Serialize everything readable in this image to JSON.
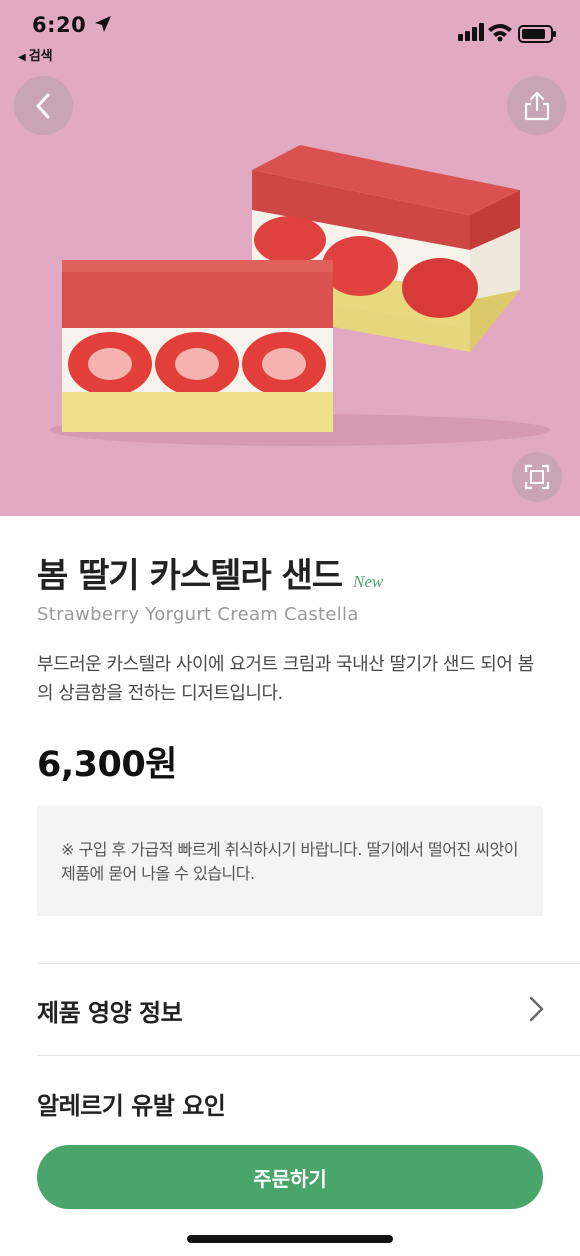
{
  "status_bar": {
    "time": "6:20",
    "back_label": "검색"
  },
  "hero": {
    "background_color": "#e2a9c2",
    "image_alt": "strawberry castella sandwich"
  },
  "product": {
    "title": "봄 딸기 카스텔라 샌드",
    "badge": "New",
    "subtitle": "Strawberry Yorgurt Cream Castella",
    "description": "부드러운 카스텔라 사이에 요거트 크림과 국내산 딸기가 샌드 되어 봄의 상큼함을 전하는 디저트입니다.",
    "price": "6,300원"
  },
  "notice": {
    "text": "※ 구입 후 가급적 빠르게 취식하시기 바랍니다. 딸기에서 떨어진 씨앗이 제품에 묻어 나올 수 있습니다."
  },
  "sections": {
    "nutrition": "제품 영양 정보",
    "allergy": "알레르기 유발 요인"
  },
  "actions": {
    "order": "주문하기"
  },
  "colors": {
    "accent": "#4aa56b",
    "badge": "#4ea96c"
  }
}
